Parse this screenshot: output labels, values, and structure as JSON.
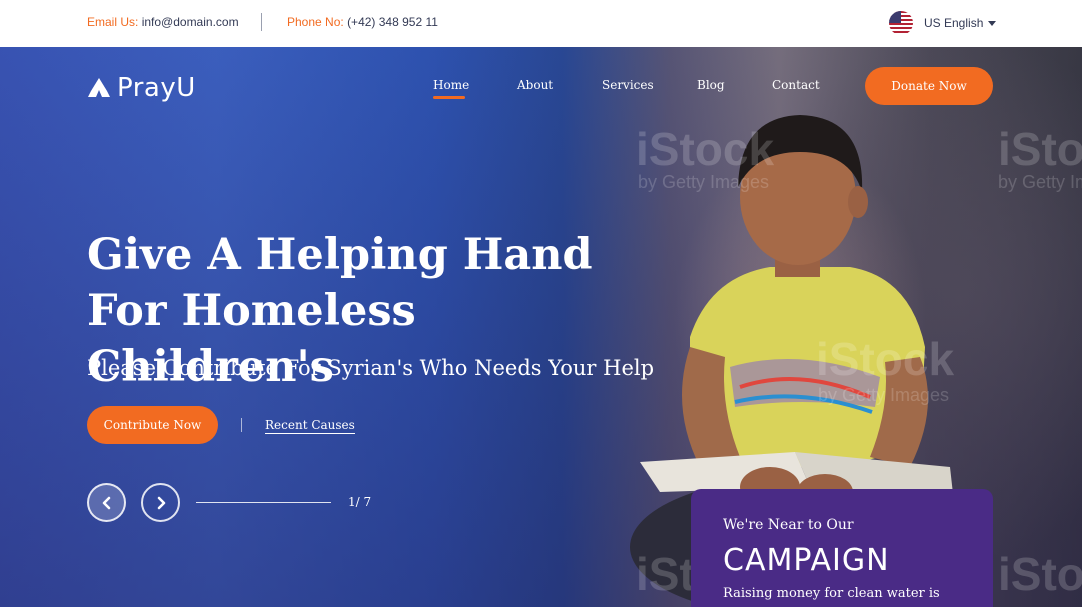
{
  "topbar": {
    "email_label": "Email Us:",
    "email_value": "info@domain.com",
    "phone_label": "Phone No:",
    "phone_value": "(+42) 348 952 11",
    "language": "US English"
  },
  "brand": {
    "name": "PrayU"
  },
  "nav": {
    "items": [
      {
        "label": "Home",
        "active": true
      },
      {
        "label": "About"
      },
      {
        "label": "Services"
      },
      {
        "label": "Blog"
      },
      {
        "label": "Contact"
      }
    ],
    "donate_label": "Donate Now"
  },
  "hero": {
    "headline": "Give A Helping Hand For Homeless Children's",
    "subtitle": "Please Contribute For Syrian's Who Needs Your Help",
    "primary_button": "Contribute Now",
    "secondary_link": "Recent Causes",
    "slide_counter": "1/ 7",
    "watermark_brand": "iStock",
    "watermark_by": "by Getty Images"
  },
  "campaign": {
    "kicker": "We're Near to Our",
    "title": "CAMPAIGN",
    "desc": "Raising money for clean water is"
  },
  "colors": {
    "accent": "#f26b21",
    "campaign_bg": "#4a2b86",
    "text_dark": "#333a55"
  }
}
